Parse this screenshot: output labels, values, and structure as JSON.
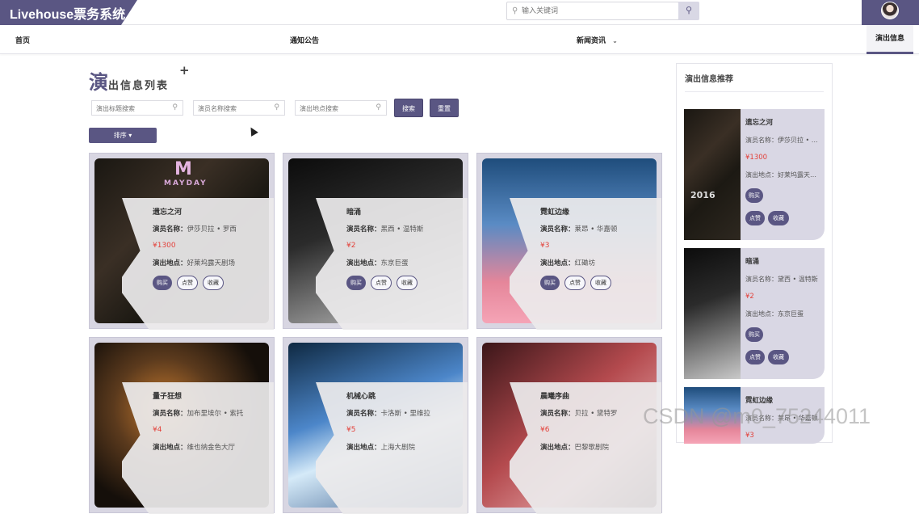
{
  "header": {
    "brand": "Livehouse票务系统",
    "search_placeholder": "输入关键词",
    "search_icon": "search-icon",
    "avatar": "user-avatar"
  },
  "nav": {
    "items": [
      {
        "label": "首页"
      },
      {
        "label": "通知公告"
      },
      {
        "label": "新闻资讯"
      }
    ],
    "active": "演出信息"
  },
  "main": {
    "title_big": "演",
    "title_rest": "出信息列表",
    "title_plus": "+",
    "filters": [
      {
        "placeholder": "演出标题搜索"
      },
      {
        "placeholder": "演员名称搜索"
      },
      {
        "placeholder": "演出地点搜索"
      }
    ],
    "search_label": "搜索",
    "reset_label": "重置",
    "sort_label": "排序 ▾",
    "labels": {
      "actor": "演员名称：",
      "place": "演出地点：",
      "buy": "购买",
      "like": "点赞",
      "fav": "收藏"
    },
    "cards": [
      {
        "title": "遗忘之河",
        "actor": "伊莎贝拉 • 罗西",
        "price": "¥1300",
        "place": "好莱坞露天剧场"
      },
      {
        "title": "暗涌",
        "actor": "黑西 • 温特斯",
        "price": "¥2",
        "place": "东京巨蛋"
      },
      {
        "title": "霓虹边缘",
        "actor": "莱昂 • 华嘉顿",
        "price": "¥3",
        "place": "红磡坊"
      },
      {
        "title": "量子狂想",
        "actor": "加布里埃尔 • 索托",
        "price": "¥4",
        "place": "维也纳金色大厅"
      },
      {
        "title": "机械心跳",
        "actor": "卡洛斯 • 里维拉",
        "price": "¥5",
        "place": "上海大剧院"
      },
      {
        "title": "晨曦序曲",
        "actor": "贝拉 • 黛特罗",
        "price": "¥6",
        "place": "巴黎歌剧院"
      }
    ],
    "poster_text": {
      "mayday": "MAYDAY"
    }
  },
  "aside": {
    "title": "演出信息推荐",
    "items": [
      {
        "title": "遗忘之河",
        "actor": "演员名称：伊莎贝拉 • …",
        "price": "¥1300",
        "place": "演出地点：好莱坞露天…",
        "year": "2016"
      },
      {
        "title": "暗涌",
        "actor": "演员名称：黛西 • 温特斯",
        "price": "¥2",
        "place": "演出地点：东京巨蛋"
      },
      {
        "title": "霓虹边缘",
        "actor": "演员名称：莱昂 • 华嘉顿",
        "price": "¥3",
        "place": ""
      }
    ],
    "labels": {
      "buy": "购买",
      "like": "点赞",
      "fav": "收藏"
    }
  },
  "watermark": "CSDN @m0_75244011",
  "colors": {
    "accent": "#5a5683",
    "price": "#e3413a"
  }
}
